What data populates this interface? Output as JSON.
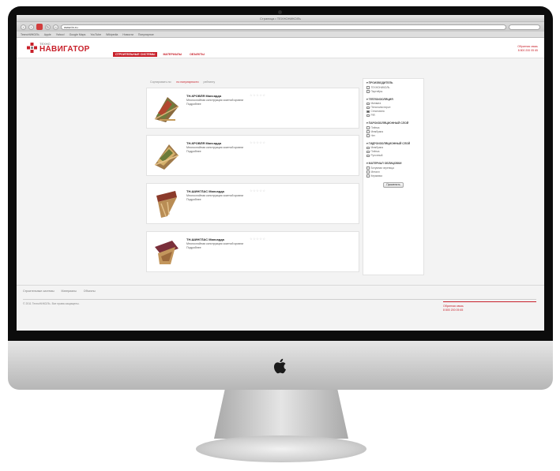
{
  "browser": {
    "window_title": "Страница • ТЕХНОНИКОЛЬ",
    "url": "www.tn.ru",
    "bookmarks": [
      "ТехноНИКОЛЬ",
      "Apple",
      "Yahoo!",
      "Google Maps",
      "YouTube",
      "Wikipedia",
      "Новости",
      "Популярное"
    ]
  },
  "site": {
    "logo_small": "ТЕХНО",
    "logo_big": "НАВИГАТОР",
    "nav": [
      "СТРОИТЕЛЬНЫЕ СИСТЕМЫ",
      "МАТЕРИАЛЫ",
      "ОБЪЕКТЫ"
    ],
    "header_contacts": [
      "Обратная связь",
      "8 800 200 05 65"
    ]
  },
  "sort": {
    "label": "Сортировать по:",
    "options": [
      "по популярности",
      "рейтингу"
    ]
  },
  "products": [
    {
      "name": "ТН-КРОВЛЯ Мансарда",
      "description": "Многослойная конструкция скатной кровли",
      "link": "Подробнее",
      "rating": "☆☆☆☆☆"
    },
    {
      "name": "ТН-КРОВЛЯ Мансарда",
      "description": "Многослойная конструкция скатной кровли",
      "link": "Подробнее",
      "rating": "☆☆☆☆☆"
    },
    {
      "name": "ТН-ШИНГЛАС Мансарда",
      "description": "Многослойная конструкция скатной кровли",
      "link": "Подробнее",
      "rating": "☆☆☆☆☆"
    },
    {
      "name": "ТН-ШИНГЛАС Мансарда",
      "description": "Многослойная конструкция скатной кровли",
      "link": "Подробнее",
      "rating": "☆☆☆☆☆"
    }
  ],
  "filters": {
    "groups": [
      {
        "title": "▾ ПРОИЗВОДИТЕЛЬ",
        "options": [
          {
            "label": "ТЕХНОНИКОЛЬ",
            "checked": false
          },
          {
            "label": "Партнёры",
            "checked": false
          }
        ]
      },
      {
        "title": "▾ ТЕПЛОИЗОЛЯЦИЯ",
        "options": [
          {
            "label": "Минвата",
            "checked": false
          },
          {
            "label": "Пенополистирол",
            "checked": false
          },
          {
            "label": "Стекловата",
            "checked": true
          },
          {
            "label": "PIR",
            "checked": false
          }
        ]
      },
      {
        "title": "▾ ПАРОИЗОЛЯЦИОННЫЙ СЛОЙ",
        "options": [
          {
            "label": "Плёнка",
            "checked": false
          },
          {
            "label": "Мембрана",
            "checked": false
          },
          {
            "label": "Нет",
            "checked": false
          }
        ]
      },
      {
        "title": "▾ ГИДРОИЗОЛЯЦИОННЫЙ СЛОЙ",
        "options": [
          {
            "label": "Мембрана",
            "checked": false
          },
          {
            "label": "Плёнка",
            "checked": false
          },
          {
            "label": "Рулонный",
            "checked": false
          }
        ]
      },
      {
        "title": "▾ МАТЕРИАЛ ОБЛИЦОВКИ",
        "options": [
          {
            "label": "Битумная черепица",
            "checked": false
          },
          {
            "label": "Металл",
            "checked": false
          },
          {
            "label": "Керамика",
            "checked": false
          }
        ]
      }
    ],
    "apply_label": "Применить"
  },
  "footer": {
    "links": [
      "Строительные системы",
      "Материалы",
      "Объекты"
    ],
    "copyright": "© 2011 ТехноНИКОЛЬ. Все права защищены.",
    "contacts": [
      "Обратная связь",
      "8 800 200 05 65"
    ]
  }
}
